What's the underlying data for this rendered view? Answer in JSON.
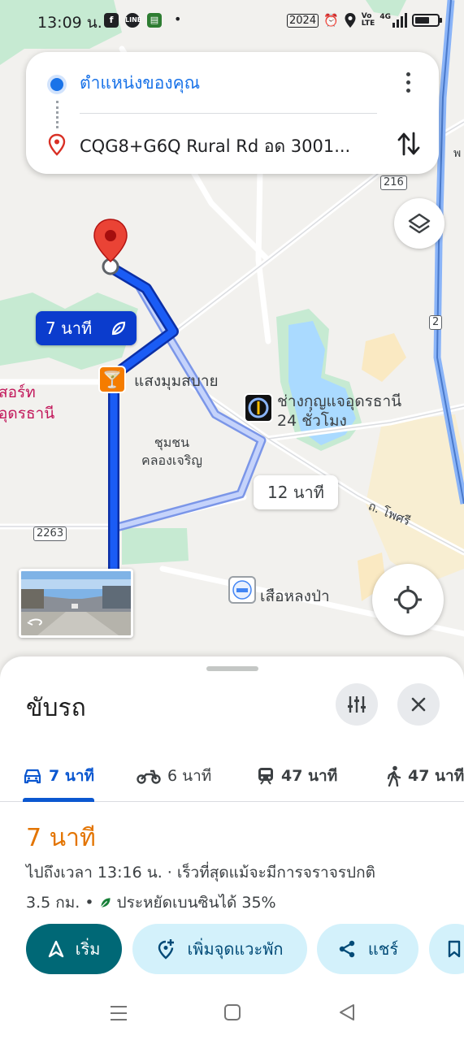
{
  "status_bar": {
    "time": "13:09 น.",
    "calendar": "2024",
    "dot": "•",
    "volte": "Vo\nLTE",
    "network": "4G"
  },
  "search": {
    "origin": "ตำแหน่งของคุณ",
    "destination": "CQG8+G6Q Rural Rd อด 3001..."
  },
  "map": {
    "labels": {
      "bar": "แสงมุมสบาย",
      "locksmith_line1": "ช่างกุญแจอุดรธานี",
      "locksmith_line2": "24 ชั่วโมง",
      "community_line1": "ชุมชน",
      "community_line2": "คลองเจริญ",
      "resort_line1": "สอร์ท",
      "resort_line2": "อุดรธานี",
      "road_phosri": "ถ. โพศรี",
      "school": "เสือหลงป่า",
      "edge_label": "พ"
    },
    "shields": [
      "216",
      "2",
      "2263"
    ],
    "route_primary_time": "7 นาที",
    "route_alt_time": "12 นาที"
  },
  "sheet": {
    "title": "ขับรถ",
    "tabs": [
      {
        "icon": "car-icon",
        "label": "7 นาที"
      },
      {
        "icon": "motorcycle-icon",
        "label": "6 นาที"
      },
      {
        "icon": "transit-icon",
        "label": "47 นาที"
      },
      {
        "icon": "walk-icon",
        "label": "47 นาที"
      }
    ],
    "eta": "7 นาที",
    "detail_line1": "ไปถึงเวลา 13:16 น. · เร็วที่สุดแม้จะมีการจราจรปกติ",
    "distance": "3.5 กม.",
    "separator": "•",
    "fuel": "ประหยัดเบนซินได้ 35%",
    "actions": {
      "start": "เริ่ม",
      "add_stop": "เพิ่มจุดแวะพัก",
      "share": "แชร์"
    }
  },
  "colors": {
    "route": "#0b3ccd",
    "alt_route": "#a4b8ef",
    "eta": "#e37400",
    "primary_button": "#006876",
    "water": "#aadaff",
    "park": "#c2ecd2"
  }
}
